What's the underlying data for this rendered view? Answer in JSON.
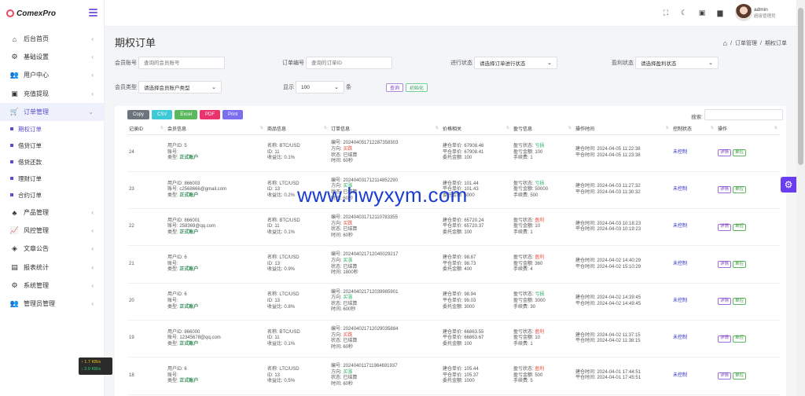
{
  "brand": {
    "name": "ComexPro"
  },
  "sidebar": {
    "items": [
      {
        "label": "后台首页",
        "icon": "home-icon",
        "glyph": "⌂"
      },
      {
        "label": "基础设置",
        "icon": "settings-icon",
        "glyph": "⚙"
      },
      {
        "label": "用户中心",
        "icon": "users-icon",
        "glyph": "👥"
      },
      {
        "label": "充值提现",
        "icon": "money-icon",
        "glyph": "▣"
      },
      {
        "label": "订单管理",
        "icon": "cart-icon",
        "glyph": "🛒"
      }
    ],
    "sub_items": [
      "期权订单",
      "借贷订单",
      "借贷还款",
      "理财订单",
      "合约订单"
    ],
    "items_after": [
      {
        "label": "产品管理",
        "icon": "product-icon",
        "glyph": "♣"
      },
      {
        "label": "风控管理",
        "icon": "chart-icon",
        "glyph": "📈"
      },
      {
        "label": "文章公告",
        "icon": "layers-icon",
        "glyph": "◈"
      },
      {
        "label": "报表统计",
        "icon": "report-icon",
        "glyph": "▤"
      },
      {
        "label": "系统管理",
        "icon": "gear-icon",
        "glyph": "⚙"
      },
      {
        "label": "管理员管理",
        "icon": "admin-icon",
        "glyph": "👥"
      }
    ]
  },
  "net_widget": {
    "up": "↑ 1.7 KB/s",
    "down": "↓ 2.0 KB/s"
  },
  "user": {
    "name": "admin",
    "role": "超级管理员"
  },
  "page": {
    "title": "期权订单",
    "breadcrumb": [
      "订单管理",
      "期权订单"
    ]
  },
  "filters": {
    "member_account_label": "会员账号",
    "member_account_placeholder": "查询的会员账号",
    "order_no_label": "订单编号",
    "order_no_placeholder": "查询的订单ID",
    "order_status_label": "进行状态",
    "order_status_value": "请选择订单进行状态",
    "profit_status_label": "盈利状态",
    "profit_status_value": "请选择盈利状态",
    "member_type_label": "会员类型",
    "member_type_value": "请选择会员账户类型",
    "display_label": "显示",
    "display_value": "100",
    "display_unit": "条",
    "query_button": "查询",
    "reset_button": "初始化"
  },
  "export_buttons": [
    {
      "label": "Copy",
      "color": "#6c757d"
    },
    {
      "label": "CSV",
      "color": "#3ec9d6"
    },
    {
      "label": "Excel",
      "color": "#5cb85c"
    },
    {
      "label": "PDF",
      "color": "#e8336d"
    },
    {
      "label": "Print",
      "color": "#7b6ff0"
    }
  ],
  "search_label": "搜索:",
  "table": {
    "headers": [
      "记录ID",
      "会员信息",
      "商品信息",
      "订单信息",
      "价格相关",
      "盈亏信息",
      "操作时间",
      "控制状态",
      "操作"
    ],
    "label_user_id": "用户ID:",
    "label_account": "账号:",
    "label_type": "类型:",
    "label_name": "名称:",
    "label_pid": "ID:",
    "label_rate": "收益比:",
    "label_no": "编号:",
    "label_dir": "方向:",
    "label_status": "状态:",
    "label_time": "时间:",
    "label_open_price": "建仓单价:",
    "label_close_price": "平仓单价:",
    "label_amount": "委托金额:",
    "label_pl_status": "盈亏状态:",
    "label_pl_amount": "盈亏金额:",
    "label_fee": "手续费:",
    "label_open_time": "建仓时间:",
    "label_close_time": "平仓时间:",
    "btn_detail": "详情",
    "btn_control": "单控",
    "rows": [
      {
        "id": "24",
        "user_id": "5",
        "account": "",
        "type": "正式账户",
        "pname": "BTC/USD",
        "pid": "11",
        "rate": "0.1%",
        "no": "20240405171228735830​3",
        "dir": "买跌",
        "dir_cls": "dir-down",
        "status": "已结算",
        "dur": "60秒",
        "open": "67908.46",
        "close": "67908.41",
        "amount": "100",
        "pl_status": "亏损",
        "pl_cls": "profit",
        "pl": "100",
        "fee": "1",
        "open_time": "2024-04-05 11:22:38",
        "close_time": "2024-04-05 11:23:38",
        "ctrl": "未控制"
      },
      {
        "id": "23",
        "user_id": "866003",
        "account": "c2568666@gmail.com",
        "type": "正式账户",
        "pname": "LTC/USD",
        "pid": "13",
        "rate": "0.2%",
        "no": "202404031712114852290",
        "dir": "买涨",
        "dir_cls": "dir-up",
        "status": "已结算",
        "dur": "60秒",
        "open": "101.44",
        "close": "101.43",
        "amount": "5000",
        "pl_status": "亏损",
        "pl_cls": "profit",
        "pl": "50000",
        "fee": "500",
        "open_time": "2024-04-03 11:27:32",
        "close_time": "2024-04-03 11:30:32",
        "ctrl": "未控制"
      },
      {
        "id": "22",
        "user_id": "866001",
        "account": "258369@qq.com",
        "type": "正式账户",
        "pname": "BTC/USD",
        "pid": "11",
        "rate": "0.1%",
        "no": "202404031712110783355",
        "dir": "买跌",
        "dir_cls": "dir-down",
        "status": "已结算",
        "dur": "60秒",
        "open": "65720.24",
        "close": "65720.37",
        "amount": "100",
        "pl_status": "盈利",
        "pl_cls": "loss",
        "pl": "10",
        "fee": "1",
        "open_time": "2024-04-03 10:18:23",
        "close_time": "2024-04-03 10:19:23",
        "ctrl": "未控制"
      },
      {
        "id": "21",
        "user_id": "6",
        "account": "",
        "type": "正式账户",
        "pname": "LTC/USD",
        "pid": "13",
        "rate": "0.9%",
        "no": "202404021712040029217",
        "dir": "买涨",
        "dir_cls": "dir-up",
        "status": "已结算",
        "dur": "1800秒",
        "open": "98.87",
        "close": "98.73",
        "amount": "400",
        "pl_status": "盈利",
        "pl_cls": "loss",
        "pl": "360",
        "fee": "4",
        "open_time": "2024-04-02 14:40:29",
        "close_time": "2024-04-02 15:10:29",
        "ctrl": "未控制"
      },
      {
        "id": "20",
        "user_id": "6",
        "account": "",
        "type": "正式账户",
        "pname": "LTC/USD",
        "pid": "13",
        "rate": "0.8%",
        "no": "202404021712039985901",
        "dir": "买涨",
        "dir_cls": "dir-up",
        "status": "已结算",
        "dur": "600秒",
        "open": "98.94",
        "close": "99.03",
        "amount": "3000",
        "pl_status": "亏损",
        "pl_cls": "profit",
        "pl": "3000",
        "fee": "30",
        "open_time": "2024-04-02 14:39:45",
        "close_time": "2024-04-02 14:49:45",
        "ctrl": "未控制"
      },
      {
        "id": "19",
        "user_id": "866000",
        "account": "12345678@qq.com",
        "type": "正式账户",
        "pname": "BTC/USD",
        "pid": "11",
        "rate": "0.1%",
        "no": "202404021712029035884",
        "dir": "买跌",
        "dir_cls": "dir-down",
        "status": "已结算",
        "dur": "60秒",
        "open": "66863.55",
        "close": "66863.67",
        "amount": "100",
        "pl_status": "盈利",
        "pl_cls": "loss",
        "pl": "10",
        "fee": "1",
        "open_time": "2024-04-02 11:37:15",
        "close_time": "2024-04-02 11:38:15",
        "ctrl": "未控制"
      },
      {
        "id": "18",
        "user_id": "6",
        "account": "",
        "type": "正式账户",
        "pname": "LTC/USD",
        "pid": "13",
        "rate": "0.5%",
        "no": "202404011711964691937",
        "dir": "买涨",
        "dir_cls": "dir-up",
        "status": "已结算",
        "dur": "60秒",
        "open": "105.44",
        "close": "105.37",
        "amount": "1000",
        "pl_status": "盈利",
        "pl_cls": "loss",
        "pl": "500",
        "fee": "5",
        "open_time": "2024-04-01 17:44:51",
        "close_time": "2024-04-01 17:45:51",
        "ctrl": "未控制"
      }
    ]
  },
  "watermark": "www.hwyxym.com"
}
